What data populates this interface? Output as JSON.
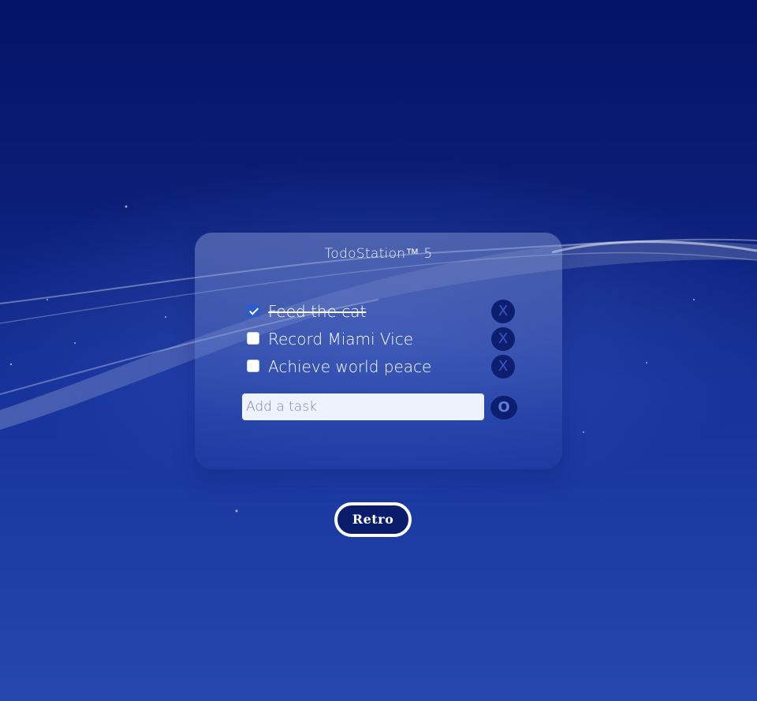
{
  "app": {
    "title": "TodoStation™ 5"
  },
  "tasks": [
    {
      "label": "Feed the cat",
      "done": true,
      "delete_label": "X"
    },
    {
      "label": "Record Miami Vice",
      "done": false,
      "delete_label": "X"
    },
    {
      "label": "Achieve world peace",
      "done": false,
      "delete_label": "X"
    }
  ],
  "add_task": {
    "placeholder": "Add a task",
    "value": "",
    "button_label": "O"
  },
  "footer": {
    "retro_label": "Retro"
  },
  "colors": {
    "background_top": "#041467",
    "background_bottom": "#2647ad",
    "button_dark": "#0d1e6e",
    "checkbox_checked": "#2c5cc9"
  },
  "icons": {
    "delete": "close-icon",
    "add": "circle-icon",
    "check": "checkmark-icon"
  }
}
